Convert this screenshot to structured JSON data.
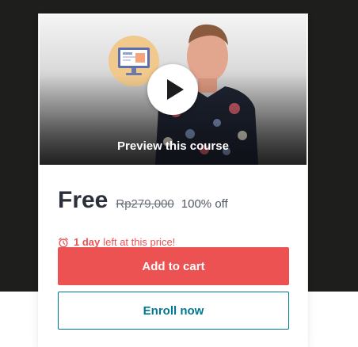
{
  "colors": {
    "backdrop": "#1e1e1c",
    "price_text": "#29303b",
    "accent_red": "#ec5252",
    "accent_teal": "#007791"
  },
  "preview": {
    "label": "Preview this course",
    "icons": [
      "play-icon",
      "monitor-icon"
    ]
  },
  "pricing": {
    "current": "Free",
    "original": "Rp279,000",
    "discount": "100% off"
  },
  "timer": {
    "icon": "alarm-clock-icon",
    "highlight": "1 day",
    "rest": "left at this price!"
  },
  "actions": {
    "add_to_cart": "Add to cart",
    "enroll_now": "Enroll now"
  }
}
